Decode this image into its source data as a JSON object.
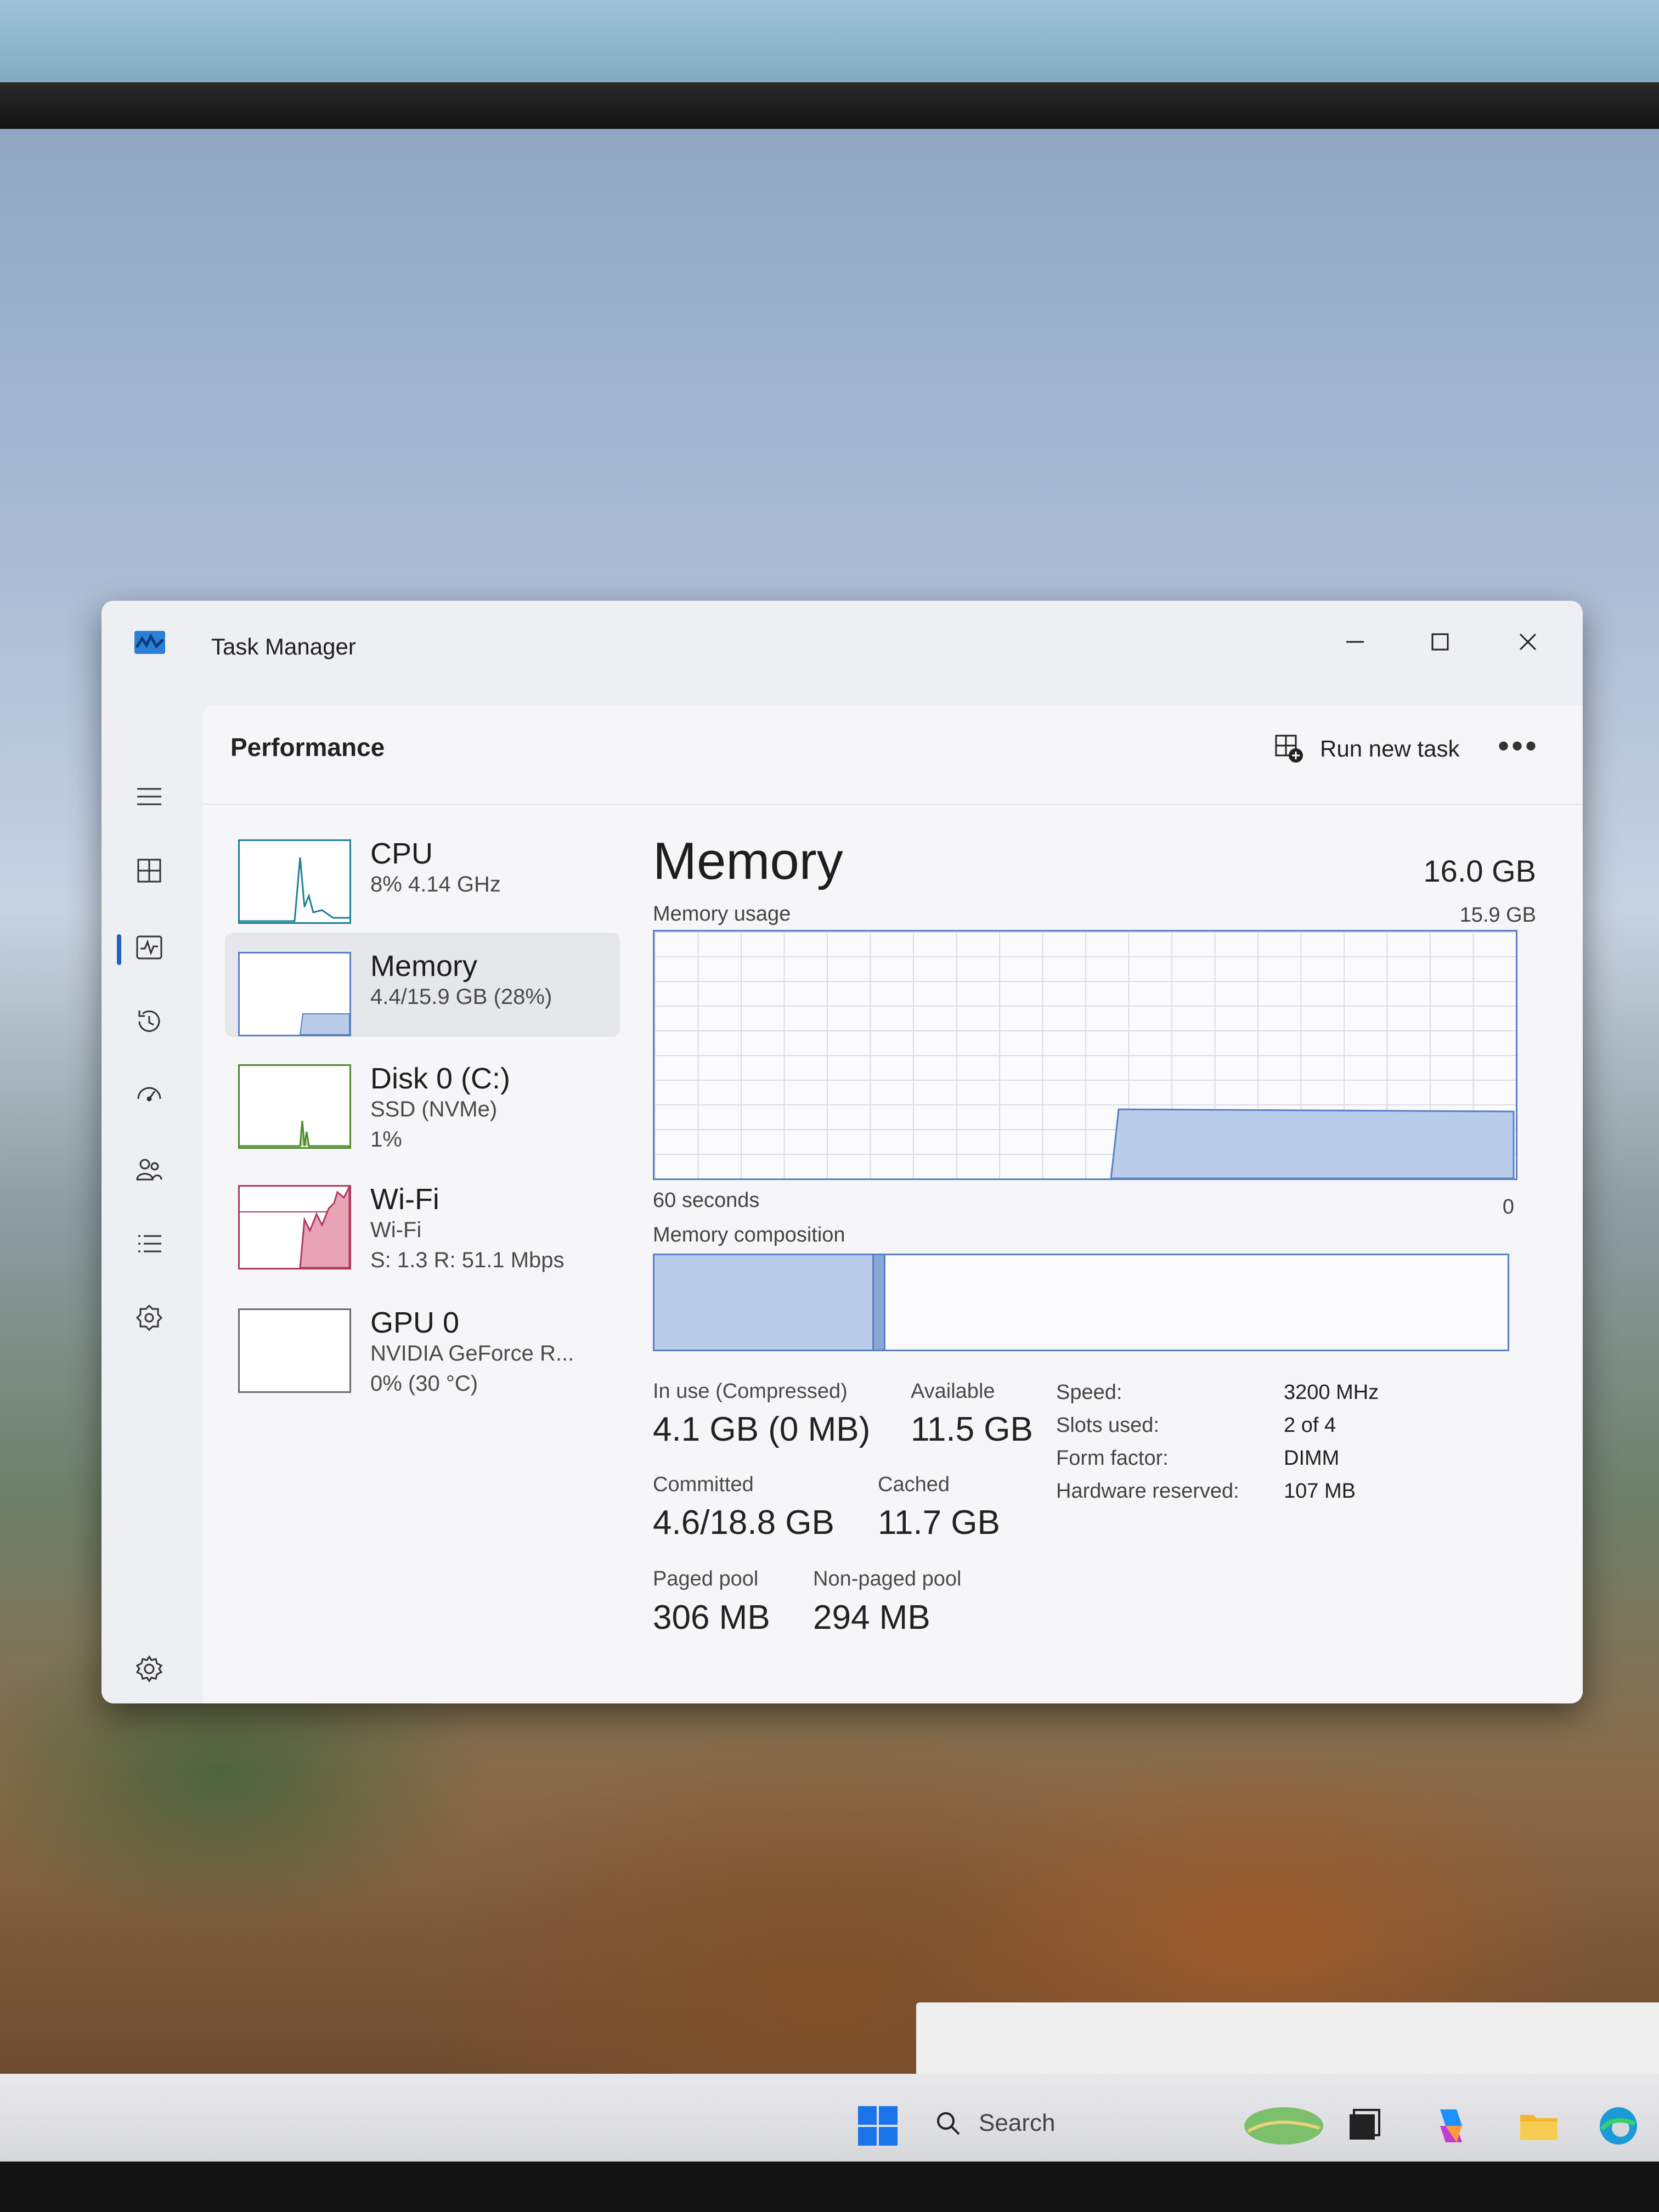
{
  "window": {
    "title": "Task Manager"
  },
  "header": {
    "title": "Performance",
    "run_new_task": "Run new task",
    "more": "•••"
  },
  "nav": {
    "icons": [
      "hamburger-menu-icon",
      "processes-icon",
      "performance-icon",
      "app-history-icon",
      "startup-apps-icon",
      "users-icon",
      "details-icon",
      "services-icon",
      "settings-icon"
    ]
  },
  "resources": [
    {
      "name": "CPU",
      "sub1": "8% 4.14 GHz",
      "sub2": "",
      "sub3": "",
      "color": "#1e7f98"
    },
    {
      "name": "Memory",
      "sub1": "4.4/15.9 GB (28%)",
      "sub2": "",
      "sub3": "",
      "color": "#5b7fc4",
      "selected": true
    },
    {
      "name": "Disk 0 (C:)",
      "sub1": "SSD (NVMe)",
      "sub2": "1%",
      "sub3": "",
      "color": "#4f8a2b"
    },
    {
      "name": "Wi-Fi",
      "sub1": "Wi-Fi",
      "sub2": "S: 1.3 R: 51.1 Mbps",
      "sub3": "",
      "color": "#b03a5a"
    },
    {
      "name": "GPU 0",
      "sub1": "NVIDIA GeForce R...",
      "sub2": "0% (30 °C)",
      "sub3": "",
      "color": "#6b6b6b"
    }
  ],
  "detail": {
    "title": "Memory",
    "total": "16.0 GB",
    "usage_label": "Memory usage",
    "usage_max": "15.9 GB",
    "axis_left": "60 seconds",
    "axis_right": "0",
    "composition_label": "Memory composition",
    "composition": {
      "in_use_fraction": 0.255,
      "modified_fraction": 0.012
    },
    "usage_history_fraction_start": 0.53,
    "usage_level_fraction": 0.28,
    "stats": {
      "in_use_label": "In use (Compressed)",
      "in_use_value": "4.1 GB (0 MB)",
      "available_label": "Available",
      "available_value": "11.5 GB",
      "committed_label": "Committed",
      "committed_value": "4.6/18.8 GB",
      "cached_label": "Cached",
      "cached_value": "11.7 GB",
      "paged_label": "Paged pool",
      "paged_value": "306 MB",
      "nonpaged_label": "Non-paged pool",
      "nonpaged_value": "294 MB"
    },
    "specs": [
      {
        "label": "Speed:",
        "value": "3200 MHz"
      },
      {
        "label": "Slots used:",
        "value": "2 of 4"
      },
      {
        "label": "Form factor:",
        "value": "DIMM"
      },
      {
        "label": "Hardware reserved:",
        "value": "107 MB"
      }
    ]
  },
  "taskbar": {
    "search_label": "Search"
  },
  "colors": {
    "memory_fill": "#b9cce9",
    "memory_line": "#5b7fc4",
    "cpu_line": "#1e7f98",
    "disk_line": "#4f8a2b",
    "wifi_fill": "#e8a4b6",
    "wifi_line": "#b03a5a",
    "accent": "#2360c4"
  }
}
